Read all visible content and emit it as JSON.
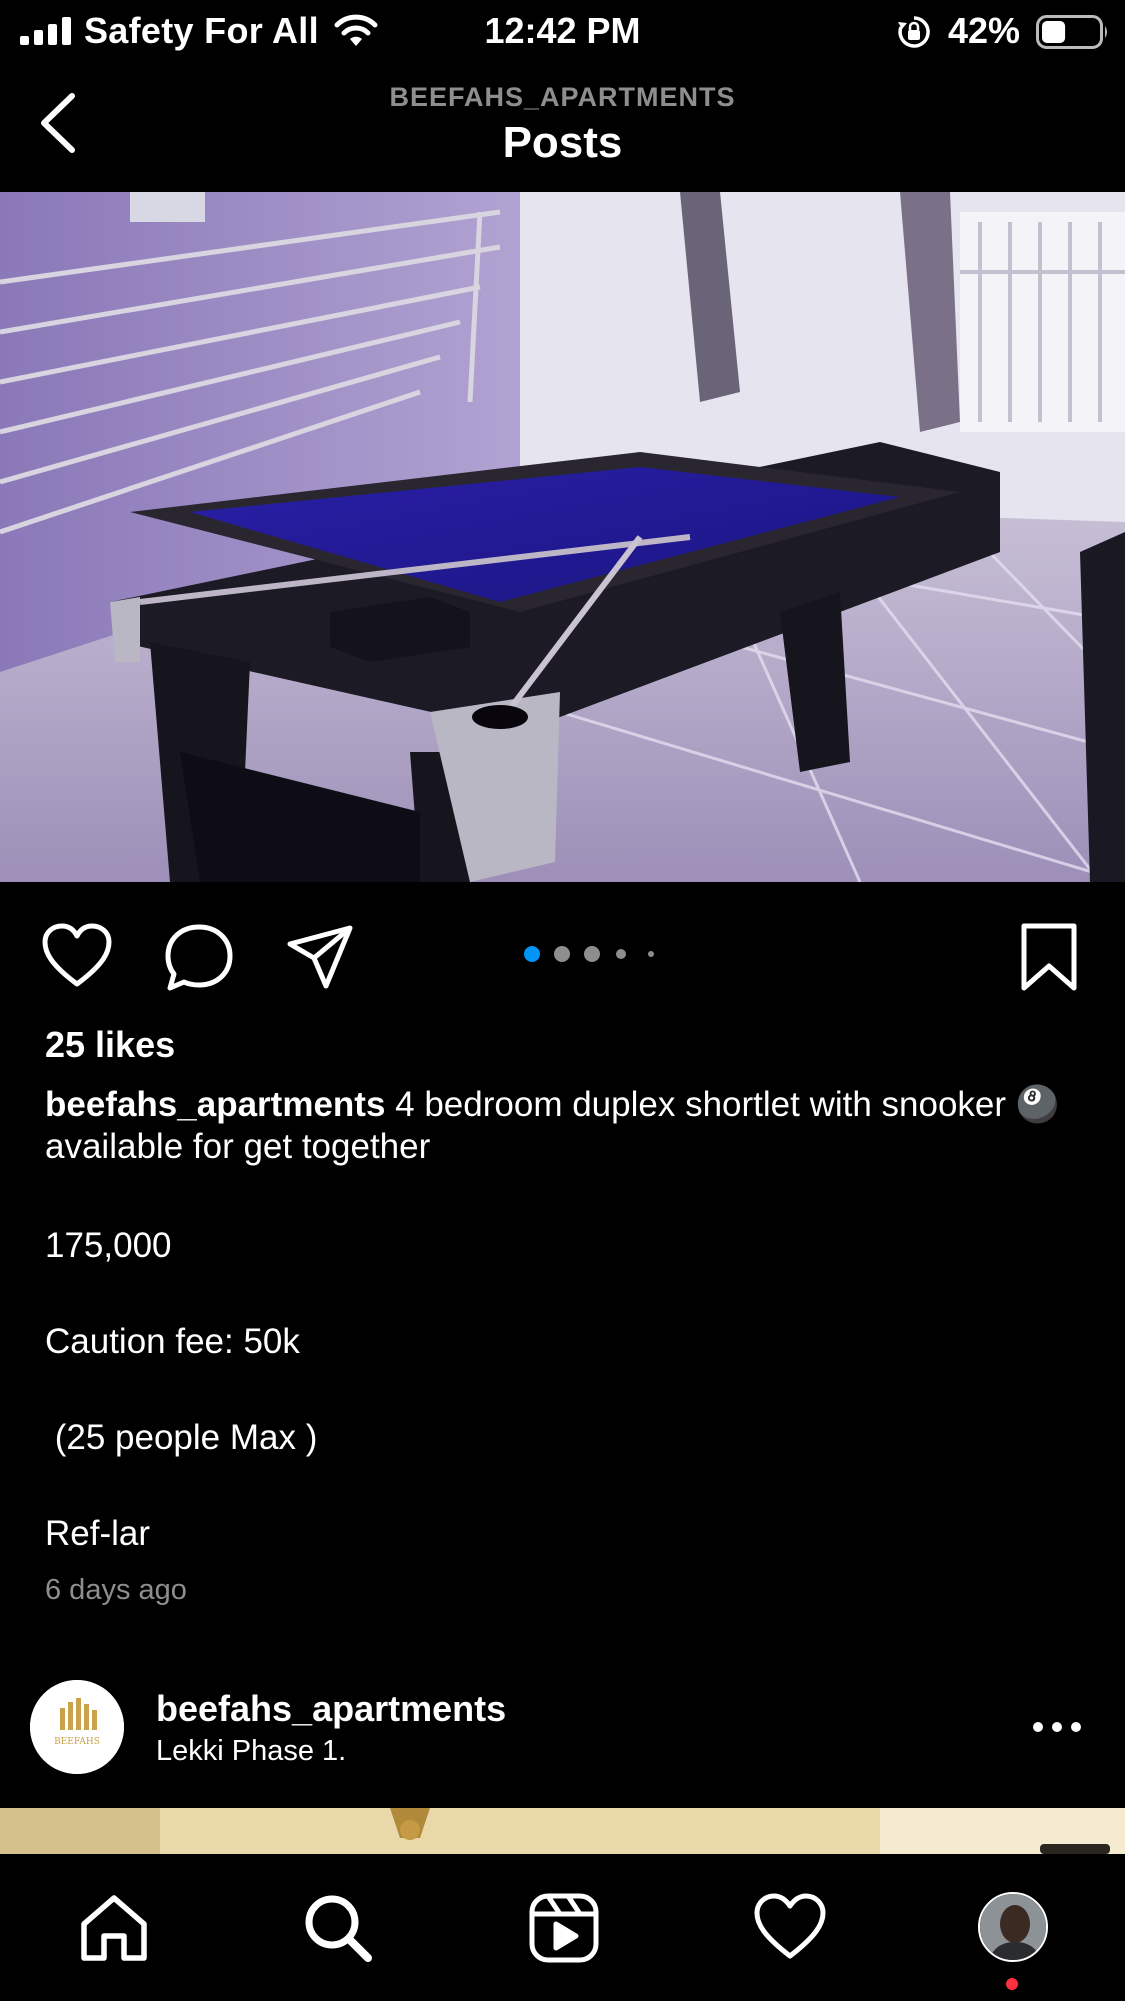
{
  "status_bar": {
    "carrier": "Safety For All",
    "time": "12:42 PM",
    "battery_percent": "42%",
    "signal_bars": 4,
    "battery_level": 0.42
  },
  "header": {
    "account": "BEEFAHS_APARTMENTS",
    "title": "Posts",
    "back_icon": "chevron-left-icon"
  },
  "post": {
    "image_description_icon": "pool-table-photo",
    "carousel": {
      "count": 5,
      "active_index": 0,
      "active_color": "#0095f6"
    },
    "likes": "25 likes",
    "username": "beefahs_apartments",
    "caption_text": "4 bedroom duplex shortlet with snooker 🎱 available for get together",
    "price": "175,000",
    "caution_fee": "Caution fee: 50k",
    "capacity": " (25 people Max )",
    "ref": "Ref-lar",
    "timestamp": "6 days ago",
    "action_icons": [
      "heart-icon",
      "comment-icon",
      "share-icon",
      "bookmark-icon"
    ]
  },
  "next_post": {
    "username": "beefahs_apartments",
    "location": "Lekki Phase 1.",
    "avatar_logo_text": "BEEFAHS",
    "more_icon": "more-horizontal-icon"
  },
  "tab_bar": {
    "items": [
      "home-icon",
      "search-icon",
      "reels-icon",
      "activity-heart-icon",
      "profile-avatar"
    ],
    "notification_color": "#ff3040"
  }
}
